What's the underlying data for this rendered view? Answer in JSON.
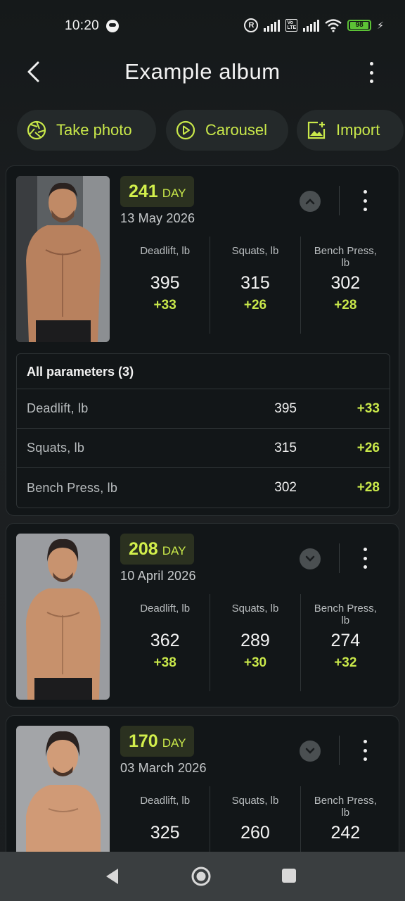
{
  "status_bar": {
    "time": "10:20",
    "battery": "98"
  },
  "header": {
    "title": "Example album"
  },
  "actions": {
    "take_photo": "Take photo",
    "carousel": "Carousel",
    "import": "Import"
  },
  "entries": [
    {
      "day_number": "241",
      "day_label": "DAY",
      "date": "13 May 2026",
      "stats": [
        {
          "label": "Deadlift, lb",
          "value": "395",
          "delta": "+33"
        },
        {
          "label": "Squats, lb",
          "value": "315",
          "delta": "+26"
        },
        {
          "label": "Bench Press, lb",
          "value": "302",
          "delta": "+28"
        }
      ],
      "params_title": "All parameters (3)",
      "params": [
        {
          "name": "Deadlift, lb",
          "value": "395",
          "delta": "+33"
        },
        {
          "name": "Squats, lb",
          "value": "315",
          "delta": "+26"
        },
        {
          "name": "Bench Press, lb",
          "value": "302",
          "delta": "+28"
        }
      ]
    },
    {
      "day_number": "208",
      "day_label": "DAY",
      "date": "10 April 2026",
      "stats": [
        {
          "label": "Deadlift, lb",
          "value": "362",
          "delta": "+38"
        },
        {
          "label": "Squats, lb",
          "value": "289",
          "delta": "+30"
        },
        {
          "label": "Bench Press, lb",
          "value": "274",
          "delta": "+32"
        }
      ]
    },
    {
      "day_number": "170",
      "day_label": "DAY",
      "date": "03 March 2026",
      "stats": [
        {
          "label": "Deadlift, lb",
          "value": "325",
          "delta": ""
        },
        {
          "label": "Squats, lb",
          "value": "260",
          "delta": ""
        },
        {
          "label": "Bench Press, lb",
          "value": "242",
          "delta": ""
        }
      ]
    }
  ],
  "colors": {
    "accent": "#c9e84a",
    "background": "#1a1d1f",
    "card": "#121618"
  },
  "icons": {
    "back": "chevron-left-icon",
    "menu": "more-vertical-icon",
    "take_photo": "aperture-icon",
    "carousel": "play-circle-icon",
    "import": "image-plus-icon",
    "expand": "chevron-up-icon",
    "collapse": "chevron-down-icon"
  }
}
